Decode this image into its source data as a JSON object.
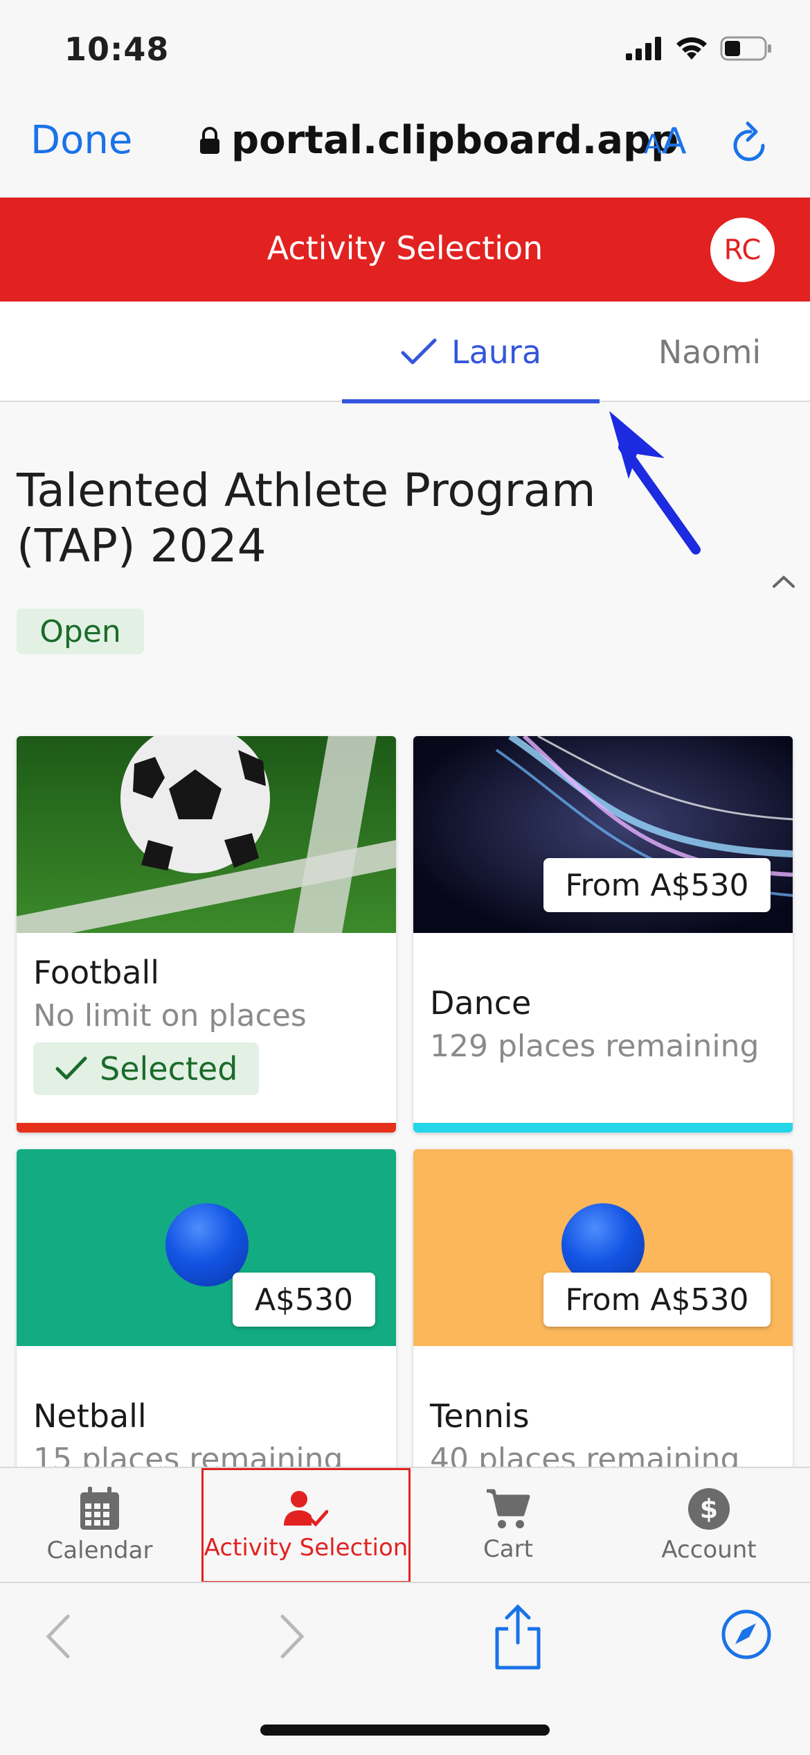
{
  "status_bar": {
    "time": "10:48"
  },
  "browser": {
    "done_label": "Done",
    "url": "portal.clipboard.app",
    "text_size_label_small": "A",
    "text_size_label_large": "A"
  },
  "header": {
    "title": "Activity Selection",
    "avatar_initials": "RC",
    "brand_color": "#e12221"
  },
  "tabs": [
    {
      "label": "Laura",
      "active": true
    },
    {
      "label": "Naomi",
      "active": false
    }
  ],
  "program": {
    "title": "Talented Athlete Program (TAP) 2024",
    "status": "Open"
  },
  "activities": [
    {
      "name": "Football",
      "availability": "No limit on places",
      "selected_label": "Selected",
      "bar_color": "#e5301c"
    },
    {
      "name": "Dance",
      "availability": "129 places remaining",
      "price": "From A$530",
      "bar_color": "#24d6e8"
    },
    {
      "name": "Netball",
      "availability": "15 places remaining",
      "price": "A$530",
      "bg_color": "#13ab82"
    },
    {
      "name": "Tennis",
      "availability": "40 places remaining",
      "price": "From A$530",
      "bg_color": "#fcb75a"
    }
  ],
  "bottom_nav": [
    {
      "label": "Calendar",
      "icon": "calendar-icon",
      "active": false
    },
    {
      "label": "Activity Selection",
      "icon": "person-check-icon",
      "active": true
    },
    {
      "label": "Cart",
      "icon": "cart-icon",
      "active": false
    },
    {
      "label": "Account",
      "icon": "dollar-icon",
      "active": false
    }
  ]
}
